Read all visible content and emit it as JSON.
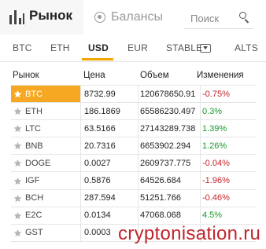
{
  "header": {
    "market_tab": "Рынок",
    "balances_tab": "Балансы",
    "search_placeholder": "Поиск"
  },
  "currency_tabs": [
    {
      "label": "BTC"
    },
    {
      "label": "ETH"
    },
    {
      "label": "USD",
      "active": true
    },
    {
      "label": "EUR"
    },
    {
      "label": "STABLE"
    },
    {
      "label": "ALTS"
    }
  ],
  "columns": {
    "market": "Рынок",
    "price": "Цена",
    "volume": "Объем",
    "change": "Изменения"
  },
  "rows": [
    {
      "coin": "BTC",
      "price": "8732.99",
      "volume": "120678650.91",
      "change": "-0.75%",
      "dir": "down",
      "selected": true
    },
    {
      "coin": "ETH",
      "price": "186.1869",
      "volume": "65586230.497",
      "change": "0.3%",
      "dir": "up"
    },
    {
      "coin": "LTC",
      "price": "63.5166",
      "volume": "27143289.738",
      "change": "1.39%",
      "dir": "up"
    },
    {
      "coin": "BNB",
      "price": "20.7316",
      "volume": "6653902.294",
      "change": "1.26%",
      "dir": "up"
    },
    {
      "coin": "DOGE",
      "price": "0.0027",
      "volume": "2609737.775",
      "change": "-0.04%",
      "dir": "down"
    },
    {
      "coin": "IGF",
      "price": "0.5876",
      "volume": "64526.684",
      "change": "-1.96%",
      "dir": "down"
    },
    {
      "coin": "BCH",
      "price": "287.594",
      "volume": "51251.766",
      "change": "-0.46%",
      "dir": "down"
    },
    {
      "coin": "E2C",
      "price": "0.0134",
      "volume": "47068.068",
      "change": "4.5%",
      "dir": "up"
    },
    {
      "coin": "GST",
      "price": "0.0003",
      "volume": "",
      "change": "",
      "dir": "down"
    }
  ],
  "watermark": "cryptonisation.ru",
  "colors": {
    "accent": "#f7a823",
    "up": "#1a9a2e",
    "down": "#c0262d"
  }
}
